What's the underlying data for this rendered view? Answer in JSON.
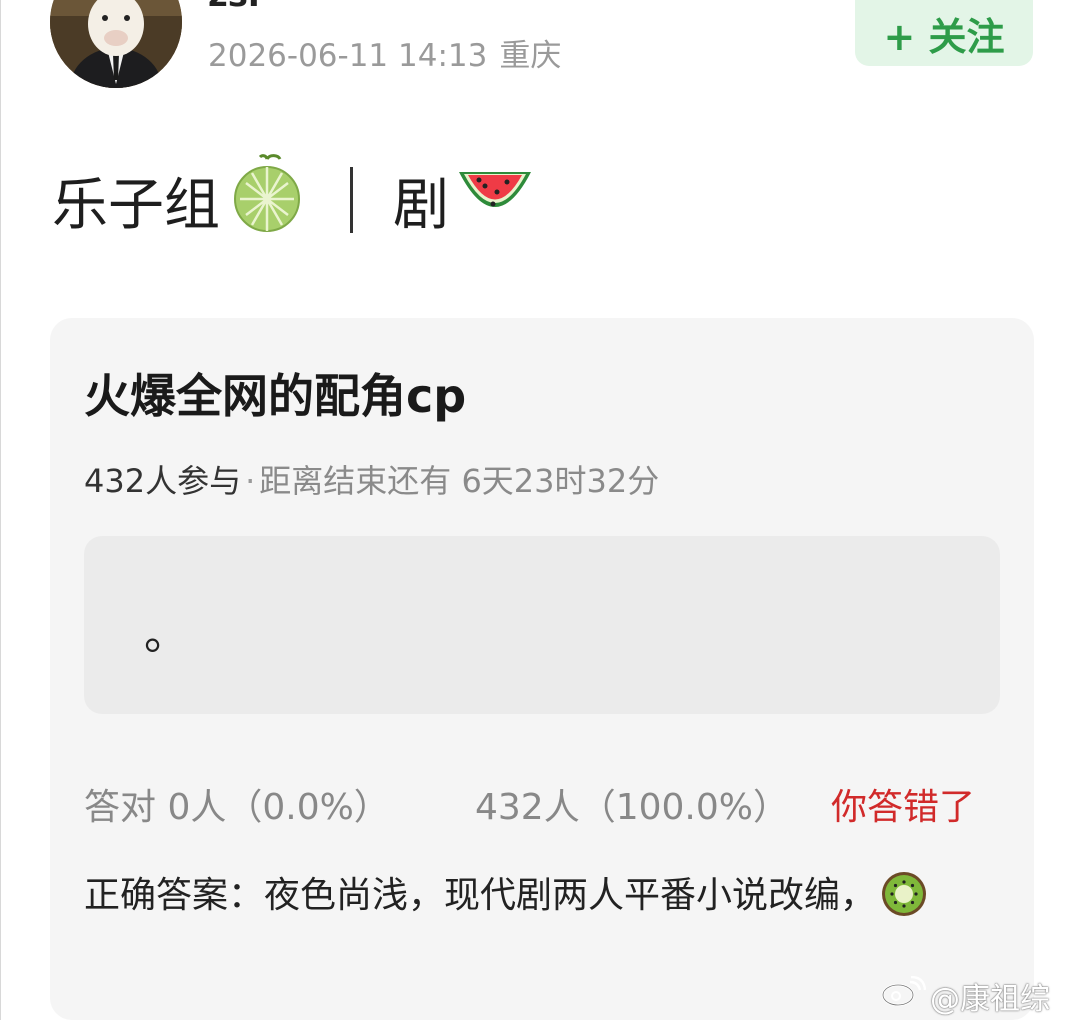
{
  "post": {
    "user_name": "zsr",
    "timestamp": "2026-06-11 14:13",
    "location": "重庆",
    "follow_label": "+ 关注",
    "text_part1": "乐子组",
    "text_part2": "剧",
    "emoji_1": "melon-emoji",
    "emoji_2": "watermelon-emoji"
  },
  "quiz": {
    "title": "火爆全网的配角cp",
    "participants": "432人参与",
    "separator": "·",
    "time_left": "距离结束还有 6天23时32分",
    "option_text": "。",
    "stats_correct": "答对  0人（0.0%）",
    "stats_wrong": "432人（100.0%）",
    "result_message": "你答错了",
    "correct_answer": "正确答案：夜色尚浅，现代剧两人平番小说改编，",
    "answer_emoji": "kiwi-emoji"
  },
  "watermark": {
    "text": "@康祖综"
  },
  "colors": {
    "follow_bg": "#e3f5e7",
    "follow_text": "#2e9c49",
    "card_bg": "#f5f5f5",
    "option_bg": "#ebebeb",
    "wrong_red": "#d12a2a",
    "meta_gray": "#9a9a9a"
  }
}
